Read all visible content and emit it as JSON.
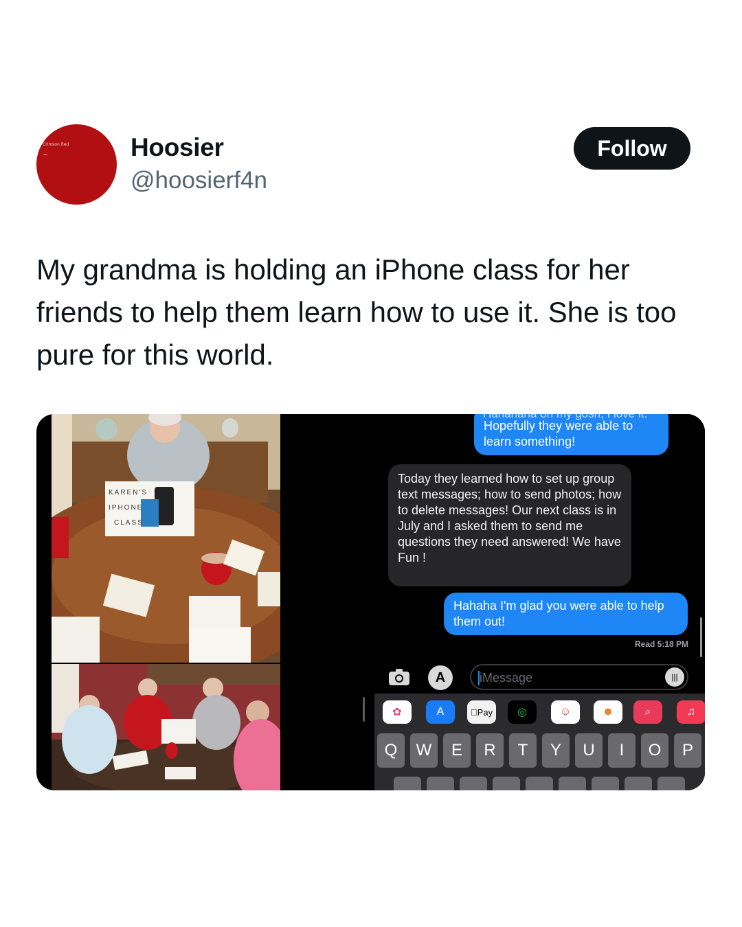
{
  "profile": {
    "avatar_text": "Crimson Red",
    "display_name": "Hoosier",
    "handle": "@hoosierf4n",
    "follow_label": "Follow"
  },
  "tweet": {
    "text": "My grandma is holding an iPhone class for her friends to help them learn how to use it. She is too pure for this world."
  },
  "media": {
    "photo_sign": [
      "KAREN'S",
      "IPHONE",
      "CLASS"
    ],
    "messages": {
      "partial_top": "Hahahaha oh my gosh, I love it.",
      "outgoing_1": "Hopefully they were able to learn something!",
      "incoming_1": "Today they learned how to set up group text messages; how to send photos; how to delete messages! Our next class is in July and I asked them to send me questions they need answered! We have Fun !",
      "outgoing_2": "Hahaha I'm glad you were able to help them out!",
      "read_receipt": "Read 5:18 PM",
      "input_placeholder": "iMessage",
      "apple_pay": "Pay"
    },
    "keyboard_row": [
      "Q",
      "W",
      "E",
      "R",
      "T",
      "Y",
      "U",
      "I",
      "O",
      "P"
    ],
    "colors": {
      "imessage_blue": "#1e86f5",
      "incoming_gray": "#262629",
      "avatar_red": "#b10f12"
    }
  }
}
